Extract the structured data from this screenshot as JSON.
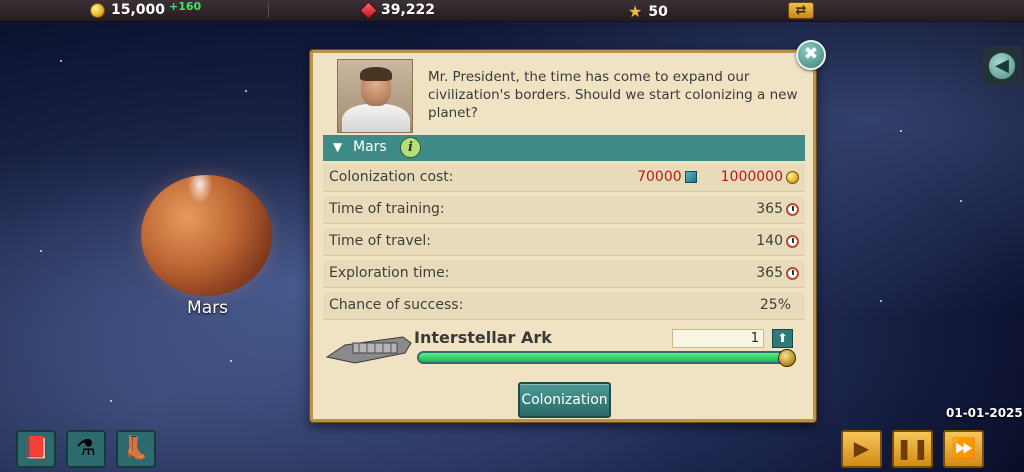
{
  "topbar": {
    "coins": "15,000",
    "coins_delta": "+160",
    "gems": "39,222",
    "stars": "50"
  },
  "planet": {
    "name": "Mars"
  },
  "dialog": {
    "message": "Mr. President, the time has come to expand our civilization's borders. Should we start colonizing a new planet?",
    "planet_header": "Mars",
    "rows": [
      {
        "label": "Colonization cost:",
        "value_resource": "70000",
        "value_coins": "1000000"
      },
      {
        "label": "Time of training:",
        "value": "365"
      },
      {
        "label": "Time of travel:",
        "value": "140"
      },
      {
        "label": "Exploration time:",
        "value": "365"
      },
      {
        "label": "Chance of success:",
        "value": "25%"
      }
    ],
    "ship_name": "Interstellar Ark",
    "quantity": "1",
    "slider_fraction": 1.0,
    "button_label": "Colonization"
  },
  "date": "01-01-2025",
  "colors": {
    "accent_teal": "#3f8b88",
    "panel_bg": "#efe3c4",
    "cost_red": "#b41c1c",
    "slider_green": "#1bb24d",
    "control_orange": "#d38a17"
  },
  "icons": {
    "coin": "coin-icon",
    "gem": "gem-icon",
    "star": "star-icon",
    "swap": "swap-icon",
    "close": "close-icon",
    "back": "back-arrow-icon",
    "info": "info-icon",
    "clock": "clock-icon",
    "resource": "cube-icon",
    "book": "book-icon",
    "flask": "flask-icon",
    "boot": "boot-icon",
    "play": "play-icon",
    "pause": "pause-icon",
    "fast_forward": "fast-forward-icon"
  }
}
